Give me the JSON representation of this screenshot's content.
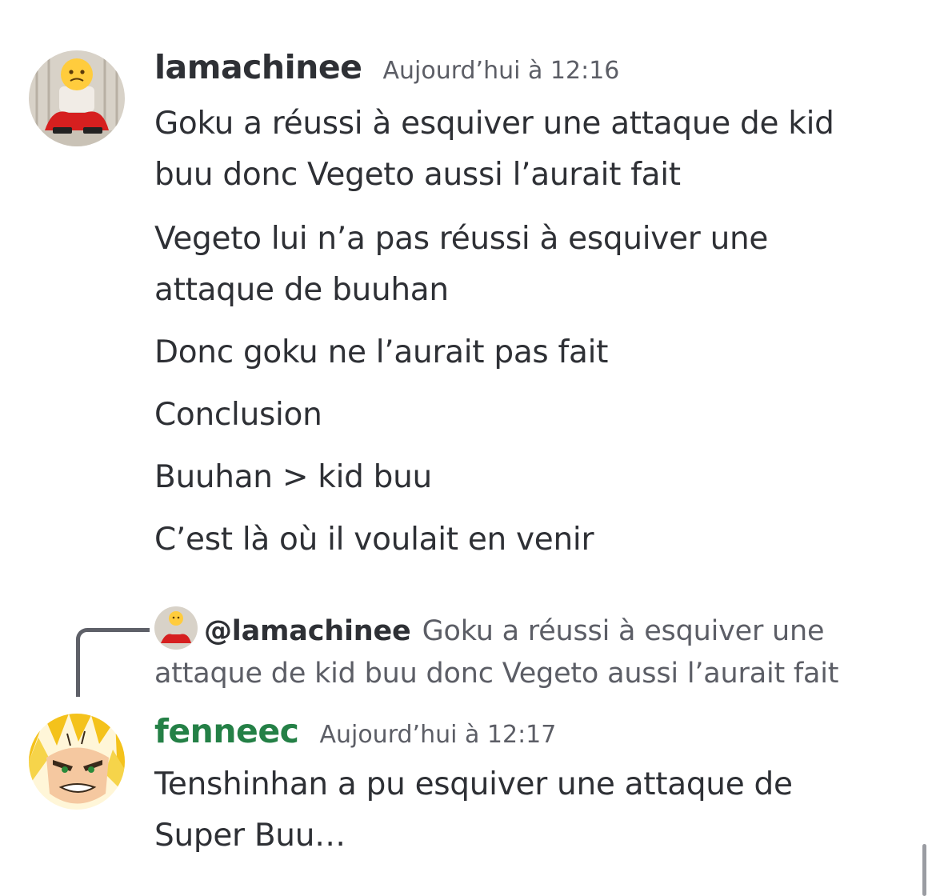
{
  "message1": {
    "username": "lamachinee",
    "username_color": "#2e3035",
    "timestamp": "Aujourd’hui à 12:16",
    "lines": [
      "Goku a réussi à esquiver une attaque de kid buu donc Vegeto aussi l’aurait fait",
      "Vegeto lui n’a pas réussi à esquiver une attaque de buuhan",
      "Donc goku ne l’aurait pas fait",
      "Conclusion",
      "Buuhan > kid buu",
      "C’est là où il voulait en venir"
    ]
  },
  "reply": {
    "mention": "@lamachinee",
    "preview": "Goku a réussi à esquiver une attaque de kid buu donc Vegeto aussi l’aurait fait"
  },
  "message2": {
    "username": "fenneec",
    "username_color": "#248046",
    "timestamp": "Aujourd’hui à 12:17",
    "text": "Tenshinhan a pu esquiver une attaque de Super Buu…"
  }
}
